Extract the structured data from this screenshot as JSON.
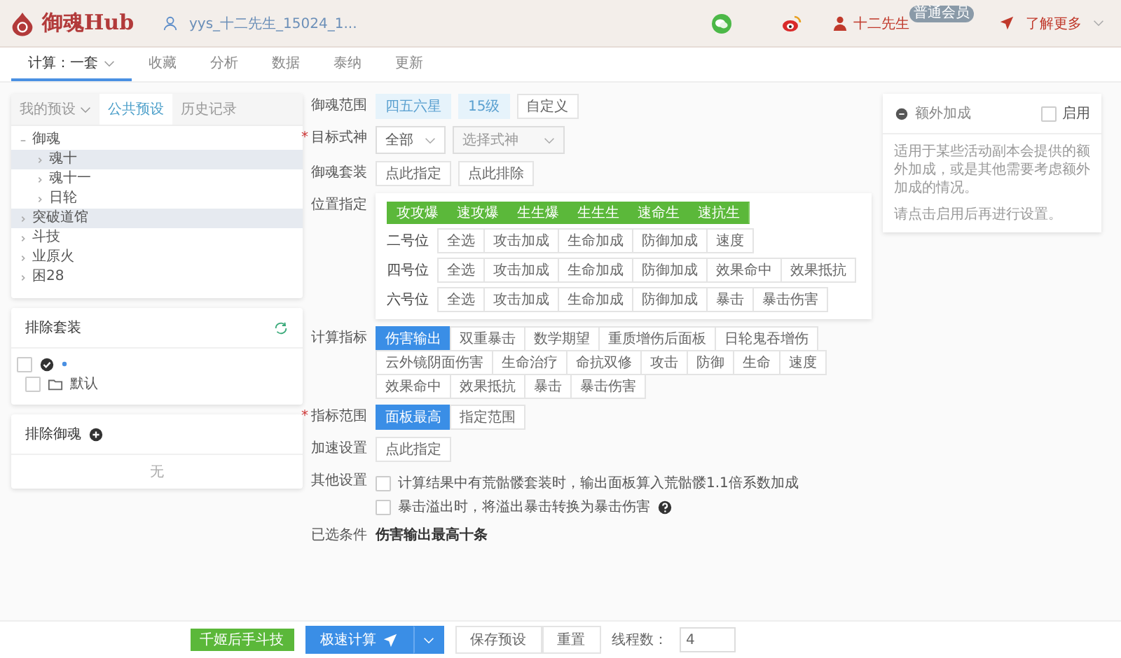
{
  "header": {
    "logo": "御魂Hub",
    "account": "yys_十二先生_15024_1...",
    "user": "十二先生",
    "badge": "普通会员",
    "more": "了解更多"
  },
  "tabs": [
    {
      "label": "计算：一套",
      "selected": true,
      "dropdown": true
    },
    {
      "label": "收藏",
      "selected": false,
      "dropdown": false
    },
    {
      "label": "分析",
      "selected": false,
      "dropdown": false
    },
    {
      "label": "数据",
      "selected": false,
      "dropdown": false
    },
    {
      "label": "泰纳",
      "selected": false,
      "dropdown": false
    },
    {
      "label": "更新",
      "selected": false,
      "dropdown": false
    }
  ],
  "presets": {
    "tabs": [
      {
        "label": "我的预设",
        "selected": false,
        "dropdown": true
      },
      {
        "label": "公共预设",
        "selected": true,
        "dropdown": false
      },
      {
        "label": "历史记录",
        "selected": false,
        "dropdown": false
      }
    ],
    "tree": [
      {
        "label": "御魂",
        "expanded": true,
        "selected": false,
        "children": [
          {
            "label": "魂十",
            "expanded": false,
            "selected": true
          },
          {
            "label": "魂十一",
            "expanded": false,
            "selected": false
          },
          {
            "label": "日轮",
            "expanded": false,
            "selected": false
          }
        ]
      },
      {
        "label": "突破道馆",
        "expanded": false,
        "selected": true
      },
      {
        "label": "斗技",
        "expanded": false,
        "selected": false
      },
      {
        "label": "业原火",
        "expanded": false,
        "selected": false
      },
      {
        "label": "困28",
        "expanded": false,
        "selected": false
      }
    ]
  },
  "exclude_sets": {
    "title": "排除套装",
    "tree": [
      {
        "checked": false,
        "children": [
          {
            "label": "默认",
            "checked": false
          }
        ]
      }
    ]
  },
  "exclude_souls": {
    "title": "排除御魂",
    "empty": "无"
  },
  "range": {
    "label": "御魂范围",
    "options": [
      {
        "label": "四五六星",
        "selected": true
      },
      {
        "label": "15级",
        "selected": true
      },
      {
        "label": "自定义",
        "selected": false
      }
    ]
  },
  "target": {
    "label": "目标式神",
    "required_mark": "*",
    "selects": [
      {
        "value": "全部",
        "disabled": false
      },
      {
        "placeholder": "选择式神",
        "disabled": true
      }
    ]
  },
  "sets": {
    "label": "御魂套装",
    "buttons": [
      "点此指定",
      "点此排除"
    ]
  },
  "positions": {
    "label": "位置指定",
    "presets": [
      "攻攻爆",
      "速攻爆",
      "生生爆",
      "生生生",
      "速命生",
      "速抗生"
    ],
    "slots": [
      {
        "label": "二号位",
        "options": [
          {
            "label": "全选",
            "selected": false
          },
          {
            "label": "攻击加成",
            "selected": false
          },
          {
            "label": "生命加成",
            "selected": false
          },
          {
            "label": "防御加成",
            "selected": false
          },
          {
            "label": "速度",
            "selected": false
          }
        ]
      },
      {
        "label": "四号位",
        "options": [
          {
            "label": "全选",
            "selected": false
          },
          {
            "label": "攻击加成",
            "selected": false
          },
          {
            "label": "生命加成",
            "selected": false
          },
          {
            "label": "防御加成",
            "selected": false
          },
          {
            "label": "效果命中",
            "selected": false
          },
          {
            "label": "效果抵抗",
            "selected": false
          }
        ]
      },
      {
        "label": "六号位",
        "options": [
          {
            "label": "全选",
            "selected": false
          },
          {
            "label": "攻击加成",
            "selected": false
          },
          {
            "label": "生命加成",
            "selected": false
          },
          {
            "label": "防御加成",
            "selected": false
          },
          {
            "label": "暴击",
            "selected": false
          },
          {
            "label": "暴击伤害",
            "selected": false
          }
        ]
      }
    ]
  },
  "metrics": {
    "label": "计算指标",
    "options": [
      {
        "label": "伤害输出",
        "selected": true
      },
      {
        "label": "双重暴击",
        "selected": false
      },
      {
        "label": "数学期望",
        "selected": false
      },
      {
        "label": "重质增伤后面板",
        "selected": false
      },
      {
        "label": "日轮鬼吞增伤",
        "selected": false
      },
      {
        "label": "云外镜阴面伤害",
        "selected": false
      },
      {
        "label": "生命治疗",
        "selected": false
      },
      {
        "label": "命抗双修",
        "selected": false
      },
      {
        "label": "攻击",
        "selected": false
      },
      {
        "label": "防御",
        "selected": false
      },
      {
        "label": "生命",
        "selected": false
      },
      {
        "label": "速度",
        "selected": false
      },
      {
        "label": "效果命中",
        "selected": false
      },
      {
        "label": "效果抵抗",
        "selected": false
      },
      {
        "label": "暴击",
        "selected": false
      },
      {
        "label": "暴击伤害",
        "selected": false
      }
    ]
  },
  "metric_range": {
    "label": "指标范围",
    "required_mark": "*",
    "options": [
      {
        "label": "面板最高",
        "selected": true
      },
      {
        "label": "指定范围",
        "selected": false
      }
    ]
  },
  "speed": {
    "label": "加速设置",
    "buttons": [
      "点此指定"
    ]
  },
  "other": {
    "label": "其他设置",
    "options": [
      {
        "text": "计算结果中有荒骷髅套装时，输出面板算入荒骷髅1.1倍系数加成",
        "checked": false,
        "help": false
      },
      {
        "text": "暴击溢出时，将溢出暴击转换为暴击伤害",
        "checked": false,
        "help": true
      }
    ]
  },
  "chosen": {
    "label": "已选条件",
    "value": "伤害输出最高十条"
  },
  "bonus": {
    "title": "额外加成",
    "enable": {
      "label": "启用",
      "checked": false
    },
    "description": "适用于某些活动副本会提供的额外加成，或是其他需要考虑额外加成的情况。",
    "hint": "请点击启用后再进行设置。"
  },
  "footer": {
    "pvp": "千姬后手斗技",
    "compute": "极速计算",
    "save": "保存预设",
    "reset": "重置",
    "threads_label": "线程数：",
    "threads": "4"
  }
}
